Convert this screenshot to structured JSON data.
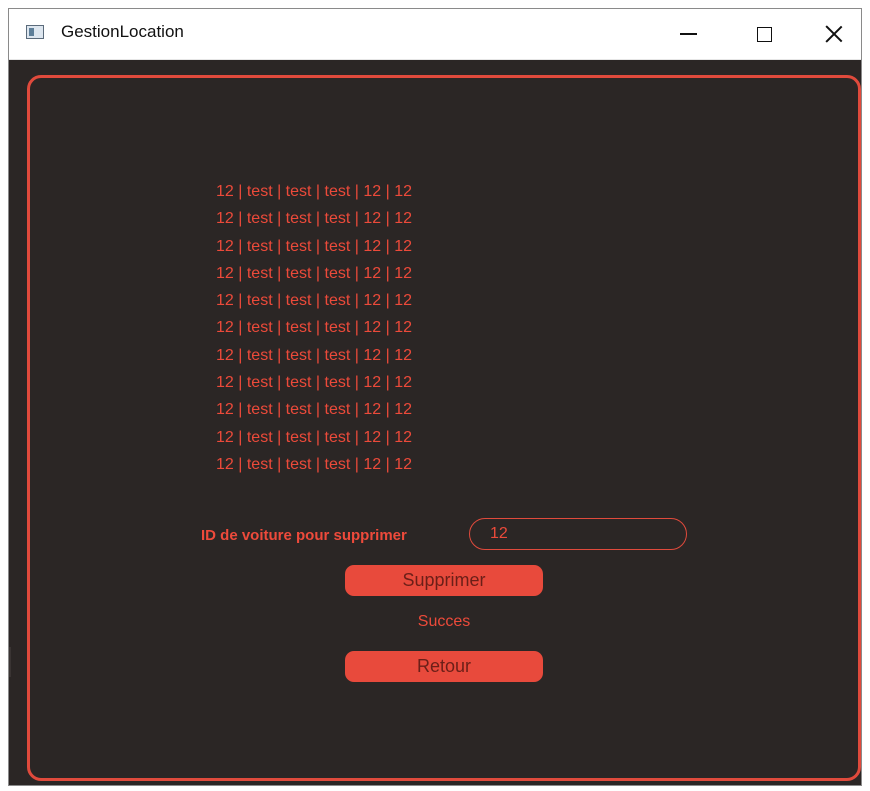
{
  "window": {
    "title": "GestionLocation",
    "controls": [
      "minimize-icon",
      "maximize-icon",
      "close-icon"
    ]
  },
  "list": {
    "rows": [
      "12 | test | test | test | 12 | 12",
      "12 | test | test | test | 12 | 12",
      "12 | test | test | test | 12 | 12",
      "12 | test | test | test | 12 | 12",
      "12 | test | test | test | 12 | 12",
      "12 | test | test | test | 12 | 12",
      "12 | test | test | test | 12 | 12",
      "12 | test | test | test | 12 | 12",
      "12 | test | test | test | 12 | 12",
      "12 | test | test | test | 12 | 12",
      "12 | test | test | test | 12 | 12"
    ]
  },
  "form": {
    "id_label": "ID de voiture pour supprimer",
    "id_value": "12",
    "delete_label": "Supprimer",
    "status": "Succes",
    "back_label": "Retour"
  },
  "colors": {
    "background": "#2b2625",
    "accent": "#e84a3c",
    "text": "#ec4a3a"
  }
}
